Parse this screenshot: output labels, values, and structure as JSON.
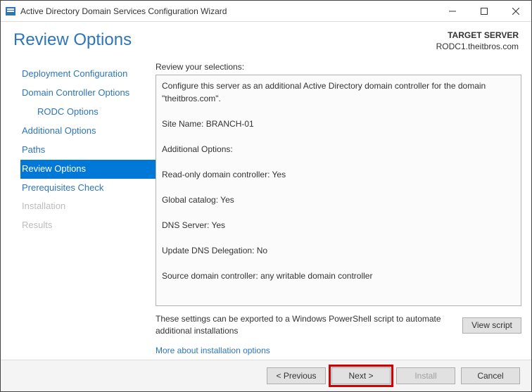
{
  "window": {
    "title": "Active Directory Domain Services Configuration Wizard"
  },
  "header": {
    "title": "Review Options",
    "target_label": "TARGET SERVER",
    "target_value": "RODC1.theitbros.com"
  },
  "nav": {
    "items": [
      {
        "label": "Deployment Configuration",
        "state": "normal"
      },
      {
        "label": "Domain Controller Options",
        "state": "normal"
      },
      {
        "label": "RODC Options",
        "state": "sub"
      },
      {
        "label": "Additional Options",
        "state": "normal"
      },
      {
        "label": "Paths",
        "state": "normal"
      },
      {
        "label": "Review Options",
        "state": "selected"
      },
      {
        "label": "Prerequisites Check",
        "state": "normal"
      },
      {
        "label": "Installation",
        "state": "disabled"
      },
      {
        "label": "Results",
        "state": "disabled"
      }
    ]
  },
  "main": {
    "review_label": "Review your selections:",
    "review_text": "Configure this server as an additional Active Directory domain controller for the domain \"theitbros.com\".\n\nSite Name: BRANCH-01\n\nAdditional Options:\n\n  Read-only domain controller: Yes\n\n  Global catalog: Yes\n\n  DNS Server: Yes\n\n  Update DNS Delegation: No\n\nSource domain controller: any writable domain controller",
    "export_text": "These settings can be exported to a Windows PowerShell script to automate additional installations",
    "view_script_label": "View script",
    "more_link": "More about installation options"
  },
  "footer": {
    "previous": "< Previous",
    "next": "Next >",
    "install": "Install",
    "cancel": "Cancel"
  }
}
